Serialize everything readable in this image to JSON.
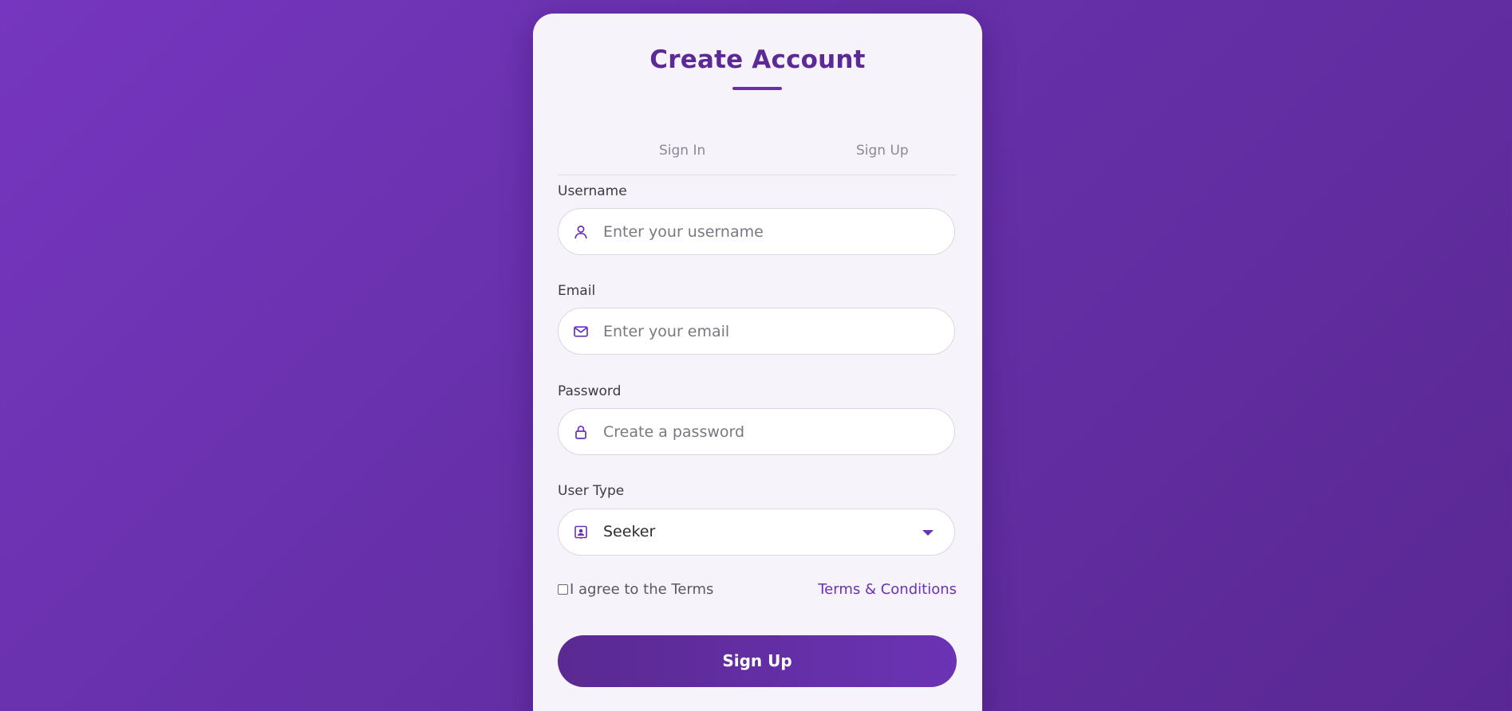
{
  "card": {
    "title": "Create Account"
  },
  "tabs": [
    {
      "label": "Sign In"
    },
    {
      "label": "Sign Up"
    }
  ],
  "form": {
    "username": {
      "label": "Username",
      "placeholder": "Enter your username",
      "value": "",
      "icon": "user-icon"
    },
    "email": {
      "label": "Email",
      "placeholder": "Enter your email",
      "value": "",
      "icon": "envelope-icon"
    },
    "password": {
      "label": "Password",
      "placeholder": "Create a password",
      "value": "",
      "icon": "lock-icon"
    },
    "user_type": {
      "label": "User Type",
      "selected": "Seeker",
      "icon": "user-badge-icon"
    }
  },
  "terms": {
    "checkbox_label": "I agree to the Terms",
    "checked": false,
    "link_text": "Terms & Conditions"
  },
  "submit": {
    "label": "Sign Up"
  },
  "colors": {
    "accent": "#6a32b3",
    "title": "#5c2a96",
    "background_start": "#7636bf",
    "background_end": "#5a2893",
    "card": "#f7f3fb"
  }
}
